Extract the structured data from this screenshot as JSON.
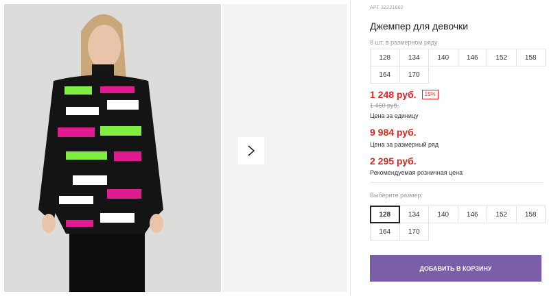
{
  "product": {
    "article": "АРТ 32221602",
    "title": "Джемпер для девочки"
  },
  "size_row": {
    "caption": "8 шт. в размерном ряду",
    "sizes": [
      "128",
      "134",
      "140",
      "146",
      "152",
      "158",
      "164",
      "170"
    ]
  },
  "pricing": {
    "price": "1 248 руб.",
    "discount": "15%",
    "old_price": "1 460 руб.",
    "unit_caption": "Цена за единицу",
    "row_price": "9 984 руб.",
    "row_caption": "Цена за размерный ряд",
    "retail_price": "2 295 руб.",
    "retail_caption": "Рекомендуемая розничная цена"
  },
  "size_select": {
    "label": "Выберите размер:",
    "sizes": [
      "128",
      "134",
      "140",
      "146",
      "152",
      "158",
      "164",
      "170"
    ],
    "selected": "128"
  },
  "cart": {
    "add_label": "ДОБАВИТЬ В КОРЗИНУ"
  },
  "colors": {
    "price_red": "#e02424",
    "button_purple": "#7b5ea8"
  },
  "icons": {
    "next": "chevron-right-icon"
  }
}
